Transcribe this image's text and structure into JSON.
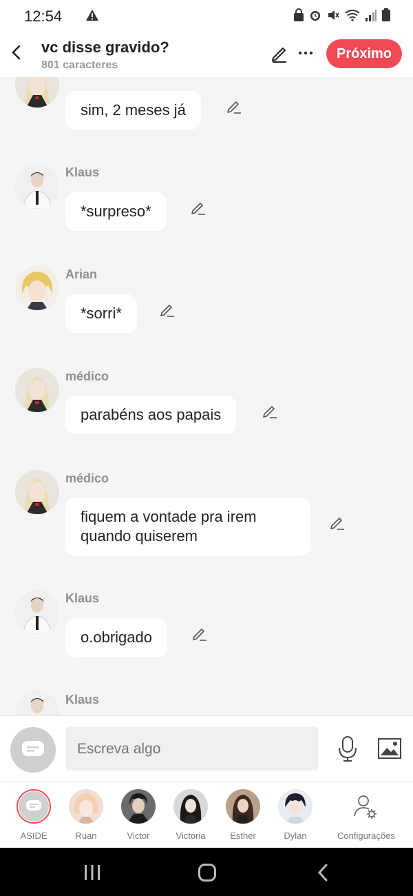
{
  "status": {
    "time": "12:54"
  },
  "header": {
    "title": "vc disse gravido?",
    "subtitle": "801 caracteres",
    "next_label": "Próximo"
  },
  "messages": [
    {
      "name": "",
      "text": "sim, 2 meses já",
      "avatar": "medico"
    },
    {
      "name": "Klaus",
      "text": "*surpreso*",
      "avatar": "klaus"
    },
    {
      "name": "Arian",
      "text": "*sorri*",
      "avatar": "arian"
    },
    {
      "name": "médico",
      "text": "parabéns aos papais",
      "avatar": "medico"
    },
    {
      "name": "médico",
      "text": "fiquem a vontade pra irem quando quiserem",
      "avatar": "medico"
    },
    {
      "name": "Klaus",
      "text": "o.obrigado",
      "avatar": "klaus"
    },
    {
      "name": "Klaus",
      "text": "",
      "avatar": "klaus"
    }
  ],
  "input": {
    "placeholder": "Escreva algo"
  },
  "characters": [
    {
      "label": "ASIDE"
    },
    {
      "label": "Ruan"
    },
    {
      "label": "Victor"
    },
    {
      "label": "Victoria"
    },
    {
      "label": "Esther"
    },
    {
      "label": "Dylan"
    },
    {
      "label": "Configurações"
    }
  ],
  "colors": {
    "accent": "#f24a55",
    "background": "#f5f5f5",
    "bubble": "#ffffff"
  }
}
